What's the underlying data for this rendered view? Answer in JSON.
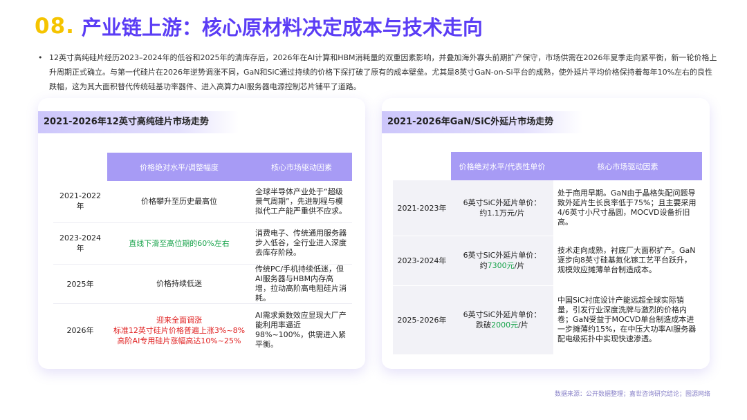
{
  "title": {
    "number": "08.",
    "text": "产业链上游：核心原材料决定成本与技术走向"
  },
  "intro": {
    "bullet": "•",
    "text": "12英寸高纯硅片经历2023–2024年的低谷和2025年的清库存后，2026年在AI计算和HBM消耗量的双重因素影响，并叠加海外寡头前期扩产保守，市场供需在2026年夏季走向紧平衡，新一轮价格上升周期正式确立。与第一代硅片在2026年逆势调涨不同，GaN和SiC通过持续的价格下探打破了原有的成本壁垒。尤其是8英寸GaN-on-Si平台的成熟，使外延片平均价格保持着每年10%左右的良性跌幅，这为其大面积替代传统硅基功率器件、进入高算力AI服务器电源控制芯片铺平了道路。"
  },
  "left_panel": {
    "header": "2021-2026年12英寸高纯硅片市场走势",
    "columns": [
      "",
      "价格绝对水平/调整幅度",
      "核心市场驱动因素"
    ],
    "rows": [
      {
        "year": "2021-2022年",
        "price": [
          "价格攀升至历史最高位"
        ],
        "price_color": "normal",
        "driver": "全球半导体产业处于“超级景气周期”，先进制程与模拟代工产能严重供不应求。"
      },
      {
        "year": "2023-2024年",
        "price": [
          "直线下滑至高位期的60%左右"
        ],
        "price_color": "green",
        "driver": "消费电子、传统通用服务器步入低谷，全行业进入深度去库存阶段。"
      },
      {
        "year": "2025年",
        "price": [
          "价格持续低迷"
        ],
        "price_color": "normal",
        "driver": "传统PC/手机持续低迷，但AI服务器与HBM内存高增，拉动高阶高电阻硅片消耗。"
      },
      {
        "year": "2026年",
        "price": [
          "迎来全面调涨",
          "标准12英寸硅片价格普遍上涨3%~8%",
          "高阶AI专用硅片涨幅高达10%~25%"
        ],
        "price_color": "red",
        "driver": "AI需求乘数效应显现大厂产能利用率逼近98%~100%，供需进入紧平衡。"
      }
    ]
  },
  "right_panel": {
    "header": "2021-2026年GaN/SiC外延片市场走势",
    "columns": [
      "",
      "价格绝对水平/代表性单价",
      "核心市场驱动因素"
    ],
    "rows": [
      {
        "year": "2021-2023年",
        "price_prefix": "6英寸SiC外延片单价：",
        "price_mid": "约1.1万元/片",
        "price_highlight": "",
        "price_suffix": "",
        "driver": "处于商用早期。GaN由于晶格失配问题导致外延片生长良率低于75%；且主要采用4/6英寸小尺寸晶圆，MOCVD设备折旧高。"
      },
      {
        "year": "2023-2024年",
        "price_prefix": "6英寸SiC外延片单价：",
        "price_mid": "约",
        "price_highlight": "7300元",
        "price_suffix": "/片",
        "driver": "技术走向成熟，衬底厂大面积扩产。GaN逐步向8英寸硅基氮化镓工艺平台跃升，规模效应摊薄单台制造成本。"
      },
      {
        "year": "2025-2026年",
        "price_prefix": "6英寸SiC外延片单价：",
        "price_mid": "跌破",
        "price_highlight": "2000元",
        "price_suffix": "/片",
        "driver": "中国SiC衬底设计产能远超全球实际销量，引发行业深度洗牌与激烈的价格内卷；GaN受益于MOCVD单台制造成本进一步摊薄约15%，在中压大功率AI服务器配电级拓扑中实现快速渗透。"
      }
    ]
  },
  "source": "数据来源：公开数据整理；嘉世咨询研究结论；图源网络",
  "colors": {
    "accent_yellow": "#f5c400",
    "accent_purple": "#5b3df5",
    "table_header": "#a79bf5",
    "green": "#17a34a",
    "red": "#e02020"
  }
}
